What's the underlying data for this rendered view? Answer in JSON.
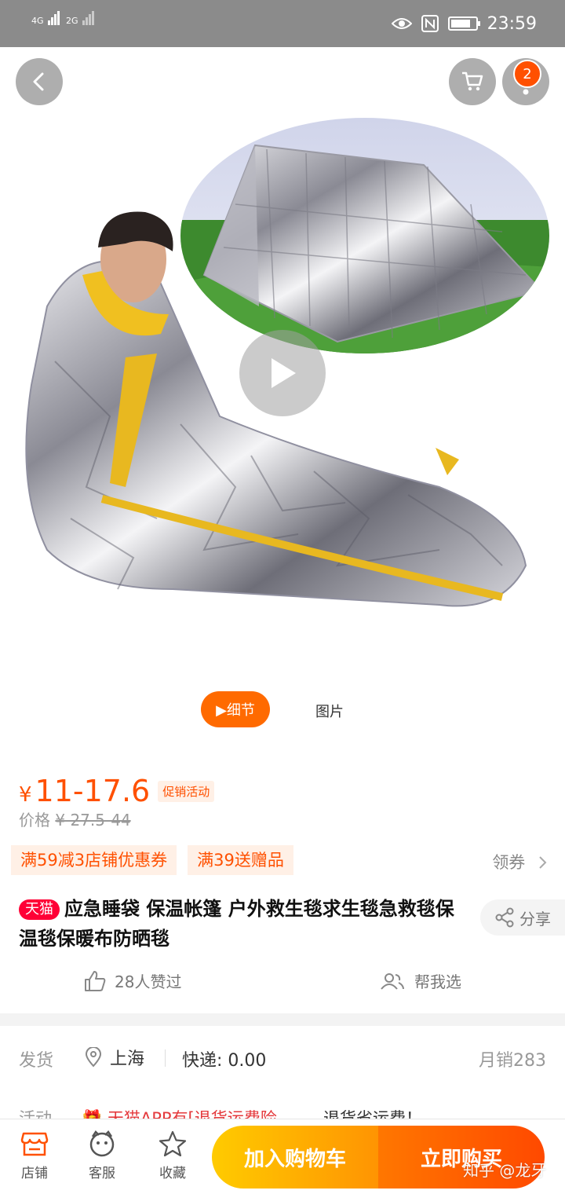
{
  "status_bar": {
    "signal_1": "4G",
    "signal_2": "2G",
    "time": "23:59",
    "icons": [
      "eye-icon",
      "nfc-icon",
      "battery-icon"
    ]
  },
  "header": {
    "cart_badge_count": "2",
    "icons": [
      "back-icon",
      "cart-icon",
      "more-icon"
    ]
  },
  "media": {
    "tabs": [
      {
        "label": "▶细节",
        "active": true
      },
      {
        "label": "图片",
        "active": false
      }
    ]
  },
  "price": {
    "currency": "¥",
    "current": "11-17.6",
    "promo_tag": "促销活动",
    "original_label": "价格",
    "original": "¥ 27.5-44"
  },
  "coupons": {
    "items": [
      "满59减3店铺优惠券",
      "满39送赠品"
    ],
    "claim_label": "领券"
  },
  "product": {
    "badge": "天猫",
    "title": "应急睡袋 保温帐篷 户外救生毯求生毯急救毯保温毯保暖布防晒毯",
    "share_label": "分享",
    "likes": "28人赞过",
    "help_choose": "帮我选"
  },
  "shipping": {
    "label": "发货",
    "location": "上海",
    "fee": "快递: 0.00",
    "monthly_sales": "月销283"
  },
  "activity": {
    "label": "活动",
    "text": "🎁 天猫APP有[退货运费险",
    "text2": "退货省运费！"
  },
  "bottom_bar": {
    "store": "店铺",
    "service": "客服",
    "favorite": "收藏",
    "add_to_cart": "加入购物车",
    "buy_now": "立即购买"
  },
  "watermark": "知乎 @龙牙",
  "colors": {
    "accent": "#ff5000",
    "tmall_red": "#ff0036",
    "cart_yellow": "#ffb400",
    "buy_orange": "#ff5a00"
  }
}
